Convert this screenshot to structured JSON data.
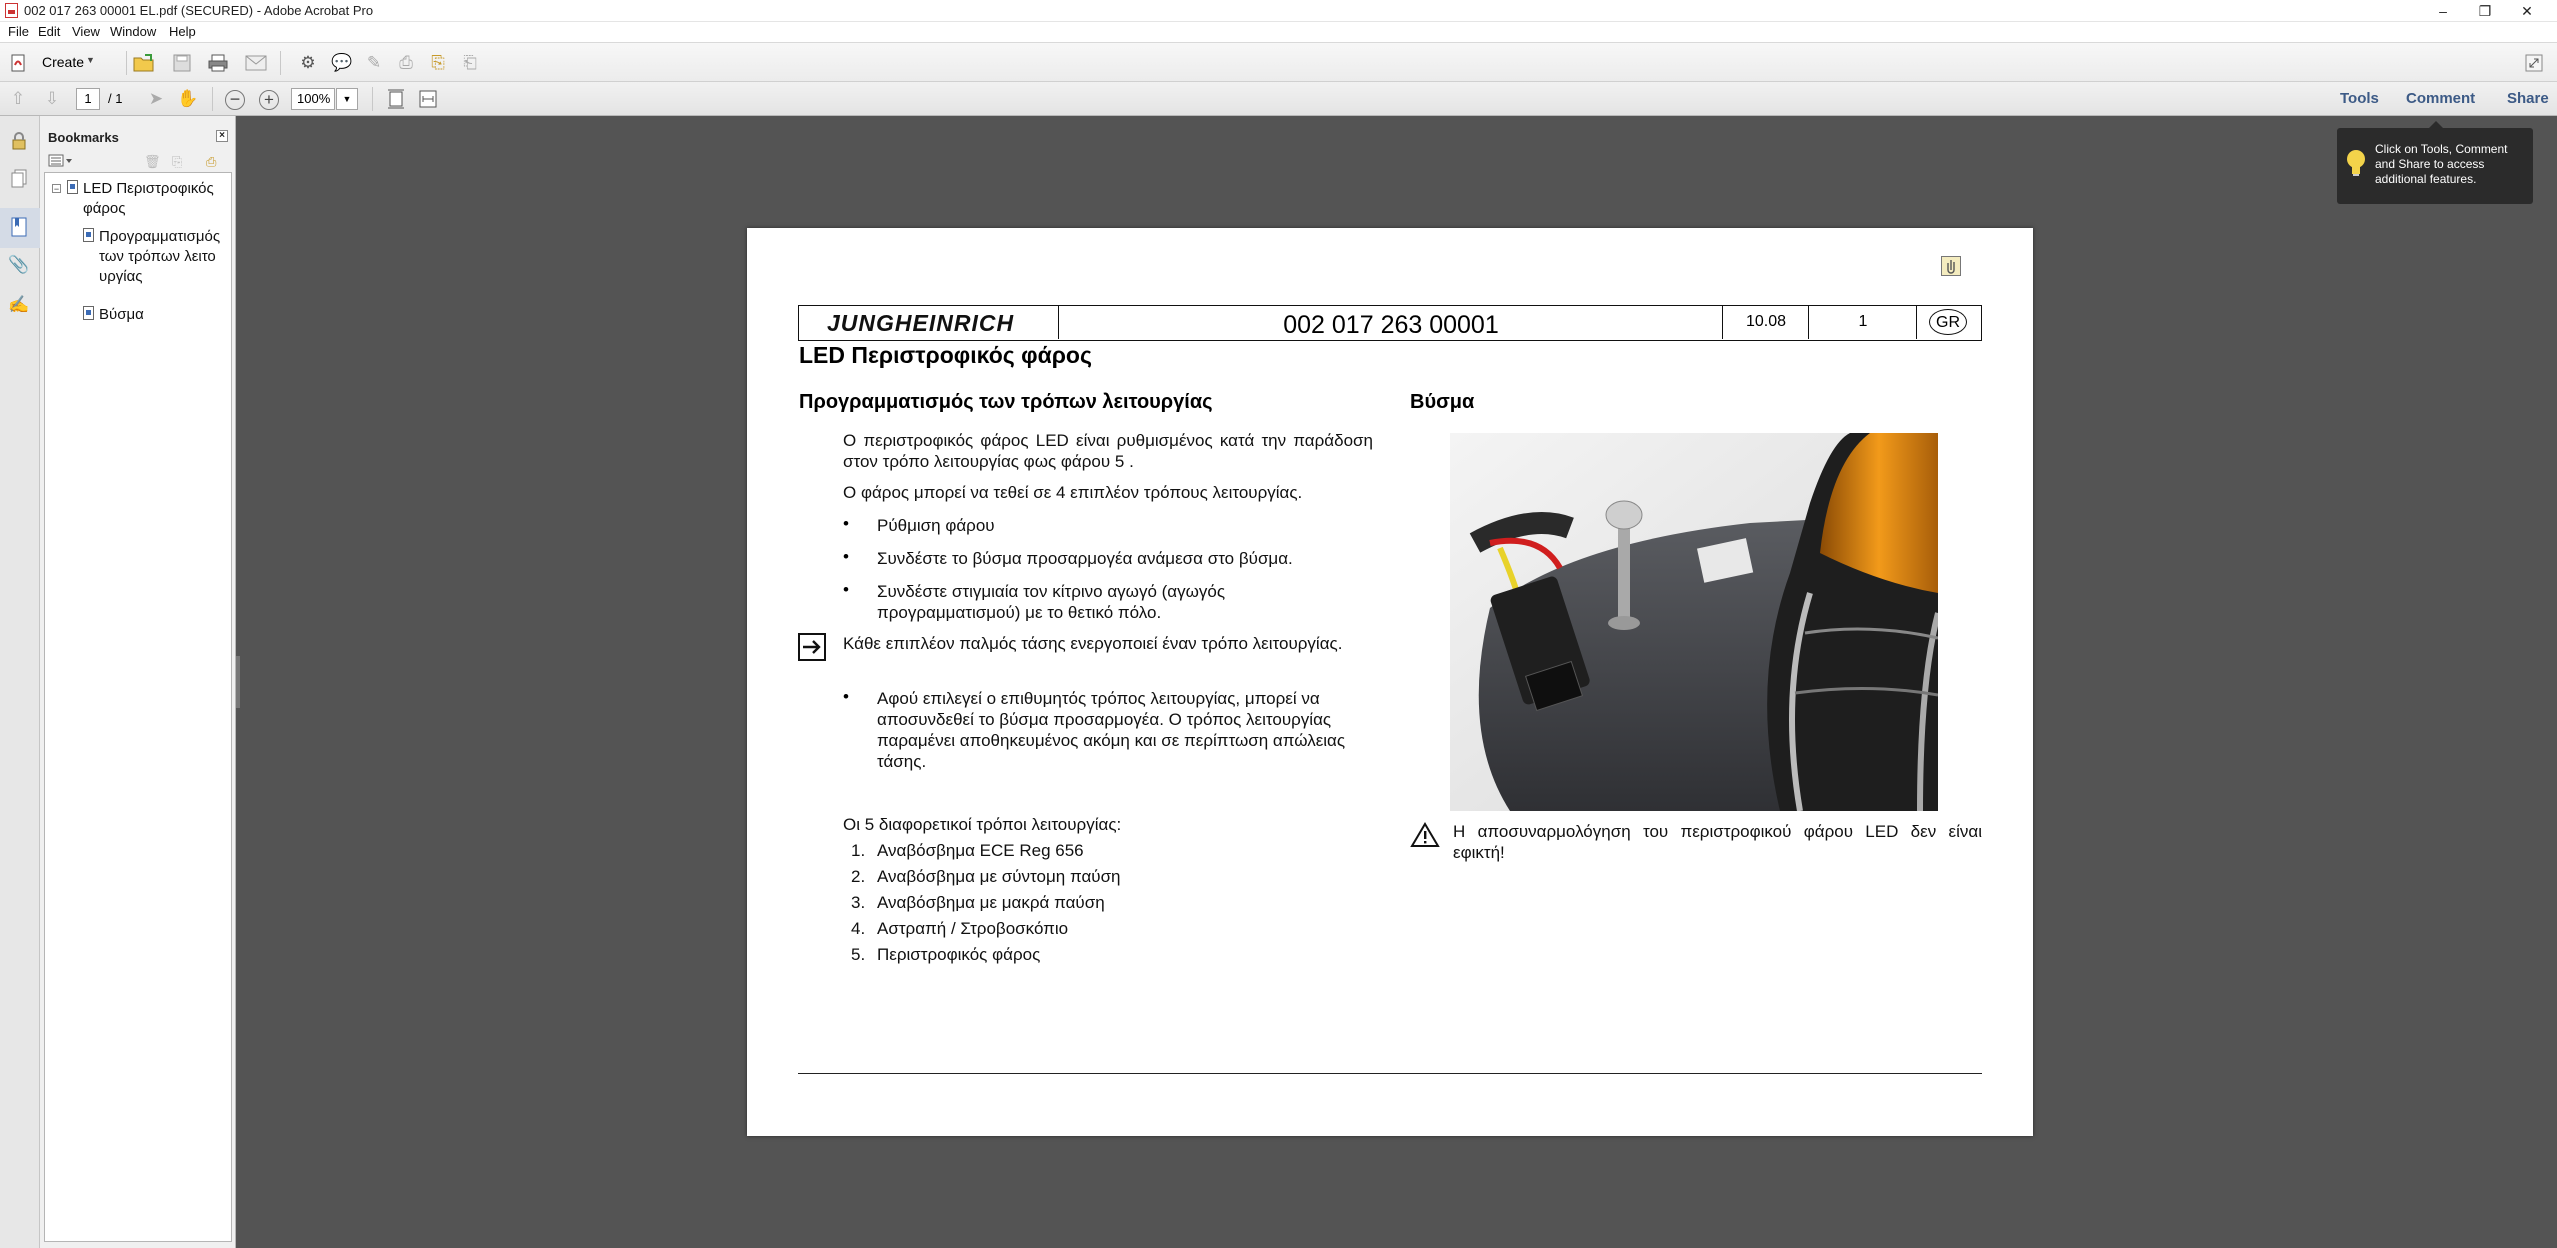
{
  "window": {
    "title": "002 017 263 00001 EL.pdf (SECURED) - Adobe Acrobat Pro",
    "controls": {
      "minimize": "–",
      "restore": "❐",
      "close": "✕"
    }
  },
  "menu": [
    "File",
    "Edit",
    "View",
    "Window",
    "Help"
  ],
  "toolbar": {
    "create_label": "Create",
    "page_current": "1",
    "page_total": "/ 1",
    "zoom": "100%",
    "right_links": [
      "Tools",
      "Comment",
      "Share"
    ]
  },
  "tooltip": {
    "text": "Click on Tools, Comment and Share to access additional features."
  },
  "bookmarks": {
    "title": "Bookmarks",
    "items": [
      {
        "label": "LED Περιστροφικός φάρος"
      },
      {
        "label": "Προγραμματισμός των τρόπων λειτουργίας"
      },
      {
        "label": "Βύσμα"
      }
    ]
  },
  "document": {
    "header": {
      "logo": "JUNGHEINRICH",
      "doc_number": "002 017 263 00001",
      "date": "10.08",
      "page": "1",
      "lang": "GR"
    },
    "title": "LED Περιστροφικός φάρος",
    "left": {
      "heading": "Προγραμματισμός των τρόπων λειτουργίας",
      "para1": "Ο περιστροφικός φάρος LED είναι ρυθμισμένος κατά την παράδοση στον τρόπο λειτουργίας φως φάρου 5 .",
      "para2": "Ο φάρος μπορεί να τεθεί σε 4 επιπλέον τρόπους λειτουργίας.",
      "bullets": [
        "Ρύθμιση φάρου",
        "Συνδέστε το βύσμα προσαρμογέα ανάμεσα στο βύσμα.",
        "Συνδέστε στιγμιαία τον κίτρινο αγωγό (αγωγός προγραμματισμού) με το θετικό πόλο."
      ],
      "note": "Κάθε επιπλέον παλμός τάσης ενεργοποιεί έναν τρόπο λειτουργίας.",
      "bullet_after": "Αφού επιλεγεί ο επιθυμητός τρόπος λειτουργίας, μπορεί να αποσυνδεθεί το βύσμα προσαρμογέα. Ο τρόπος λειτουργίας παραμένει αποθηκευμένος ακόμη και σε περίπτωση απώλειας τάσης.",
      "modes_intro": "Οι 5 διαφορετικοί τρόποι λειτουργίας:",
      "modes": [
        {
          "n": "1.",
          "text": "Αναβόσβημα ECE Reg 656"
        },
        {
          "n": "2.",
          "text": "Αναβόσβημα με σύντομη παύση"
        },
        {
          "n": "3.",
          "text": "Αναβόσβημα με μακρά παύση"
        },
        {
          "n": "4.",
          "text": "Αστραπή / Στροβοσκόπιο"
        },
        {
          "n": "5.",
          "text": "Περιστροφικός φάρος"
        }
      ]
    },
    "right": {
      "heading": "Βύσμα",
      "warning": "Η αποσυναρμολόγηση του περιστροφικού φάρου LED δεν είναι εφικτή!"
    }
  }
}
